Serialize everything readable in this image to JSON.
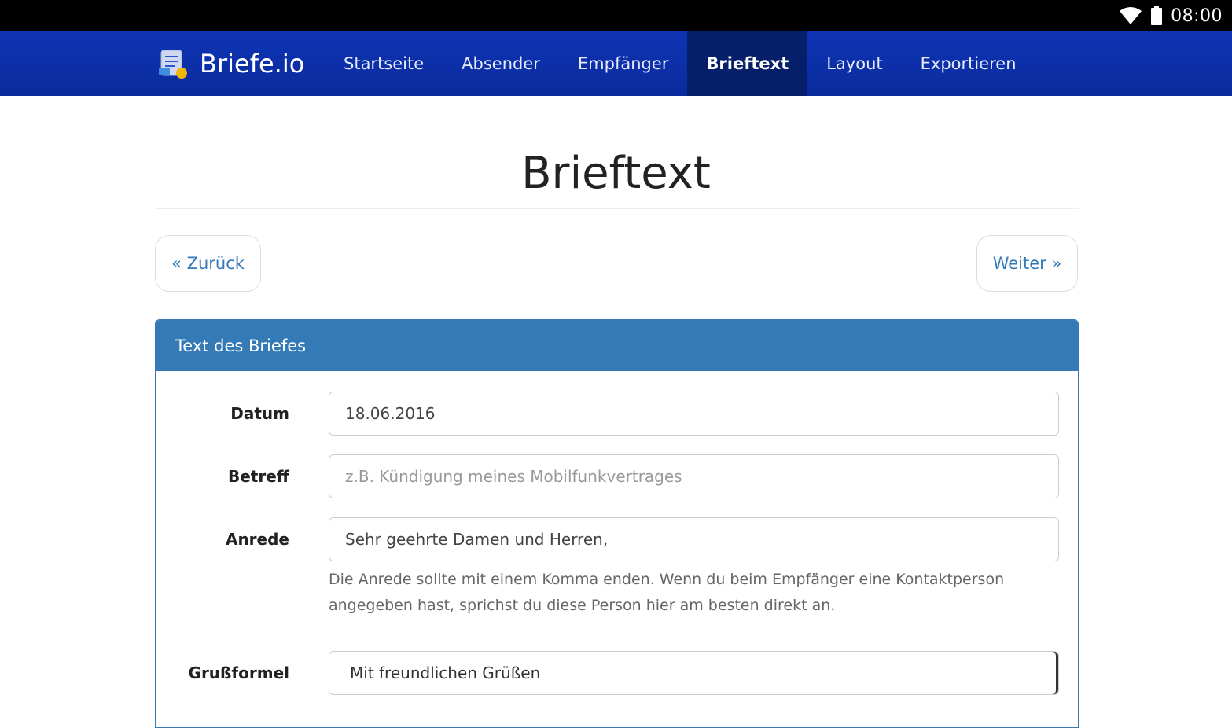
{
  "status_bar": {
    "time": "08:00",
    "wifi_icon": "wifi-icon",
    "battery_icon": "battery-icon"
  },
  "navbar": {
    "brand": "Briefe.io",
    "items": [
      {
        "label": "Startseite",
        "active": false
      },
      {
        "label": "Absender",
        "active": false
      },
      {
        "label": "Empfänger",
        "active": false
      },
      {
        "label": "Brieftext",
        "active": true
      },
      {
        "label": "Layout",
        "active": false
      },
      {
        "label": "Exportieren",
        "active": false
      }
    ]
  },
  "page": {
    "title": "Brieftext",
    "back_label": "« Zurück",
    "next_label": "Weiter »"
  },
  "panel": {
    "heading": "Text des Briefes",
    "fields": {
      "datum": {
        "label": "Datum",
        "value": "18.06.2016"
      },
      "betreff": {
        "label": "Betreff",
        "value": "",
        "placeholder": "z.B. Kündigung meines Mobilfunkvertrages"
      },
      "anrede": {
        "label": "Anrede",
        "value": "Sehr geehrte Damen und Herren,",
        "help": "Die Anrede sollte mit einem Komma enden. Wenn du beim Empfänger eine Kontaktperson angegeben hast, sprichst du diese Person hier am besten direkt an."
      },
      "grussformel": {
        "label": "Grußformel",
        "selected": "Mit freundlichen Grüßen"
      }
    }
  },
  "colors": {
    "navbar": "#0b2fa8",
    "nav_active": "#061f6b",
    "panel_primary": "#337ab7",
    "link": "#337ab7"
  }
}
